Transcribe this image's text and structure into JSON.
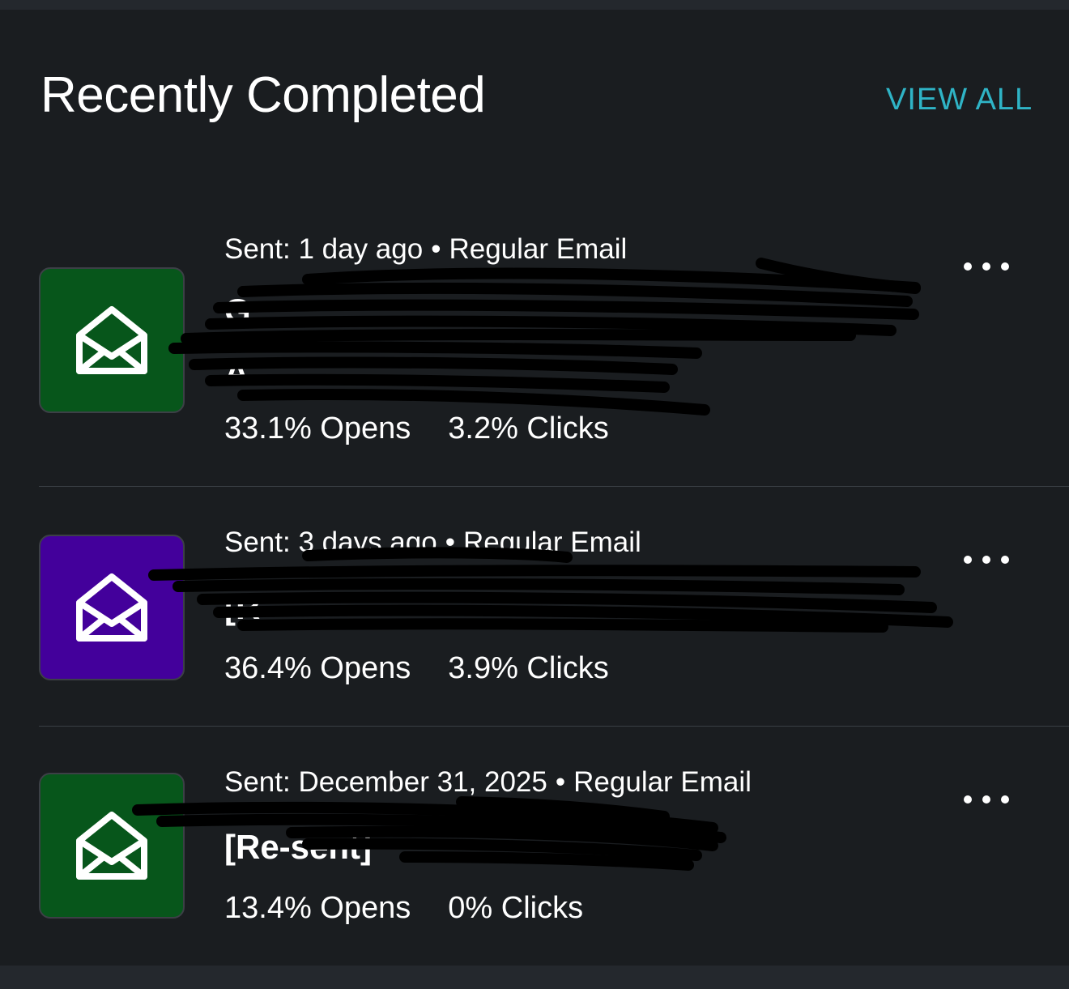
{
  "header": {
    "title": "Recently Completed",
    "view_all_label": "VIEW ALL"
  },
  "campaigns": [
    {
      "sent": "Sent: 1 day ago",
      "separator": "•",
      "type": "Regular Email",
      "subject_line_1": "G",
      "subject_line_2": "A",
      "opens": "33.1% Opens",
      "clicks": "3.2% Clicks",
      "icon": "open-envelope-icon",
      "color": "#07561b"
    },
    {
      "sent": "Sent: 3 days ago",
      "separator": "•",
      "type": "Regular Email",
      "subject_line_1": "[R",
      "opens": "36.4% Opens",
      "clicks": "3.9% Clicks",
      "icon": "open-envelope-icon",
      "color": "#43009b"
    },
    {
      "sent": "Sent: December 31, 2025",
      "separator": "•",
      "type": "Regular Email",
      "subject_line_1": "[Re-sent]",
      "opens": "13.4% Opens",
      "clicks": "0% Clicks",
      "icon": "open-envelope-icon",
      "color": "#07561b"
    }
  ]
}
